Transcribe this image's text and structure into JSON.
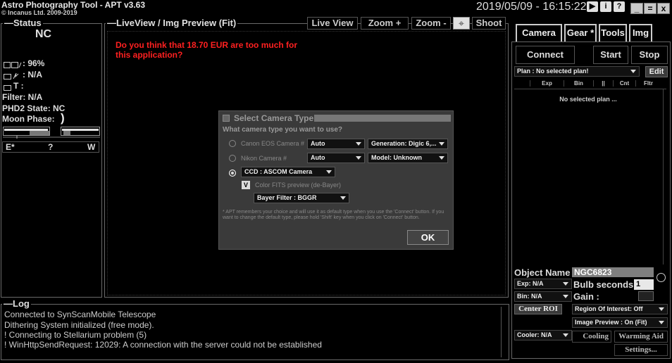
{
  "app": {
    "title": "Astro Photography Tool  -  APT v3.63",
    "copyright": "© Incanus Ltd. 2009-2019",
    "clock": "2019/05/09 - 16:15:22"
  },
  "title_buttons": [
    {
      "icon": "play-icon",
      "glyph": "▶"
    },
    {
      "icon": "info-icon",
      "glyph": "i"
    },
    {
      "icon": "help-icon",
      "glyph": "?"
    }
  ],
  "window_buttons": [
    {
      "icon": "minimize-icon",
      "glyph": "_"
    },
    {
      "icon": "maximize-icon",
      "glyph": "="
    },
    {
      "icon": "close-icon",
      "glyph": "x"
    }
  ],
  "status": {
    "legend": "Status",
    "connection": "NC",
    "battery": ": 96%",
    "power": ": N/A",
    "temp": "T :",
    "filter": "Filter: N/A",
    "phd2": "PHD2 State: NC",
    "moon": "Moon Phase:",
    "moon_glyph": ")",
    "compass": {
      "e": "E*",
      "mid": "?",
      "w": "W"
    }
  },
  "liveview": {
    "legend": "LiveView / Img Preview (Fit)",
    "buttons": [
      "Live View",
      "Zoom +",
      "Zoom -",
      "Shoot"
    ],
    "crosshair_glyph": "⌖",
    "nag": "Do you think that 18.70 EUR are too much for this application?"
  },
  "dialog": {
    "title": "Select Camera Type",
    "question": "What camera type you want to use?",
    "canon_label": "Canon EOS Camera #",
    "canon_mode": "Auto",
    "canon_generation": "Generation: Digic 6,...",
    "nikon_label": "Nikon Camera #",
    "nikon_mode": "Auto",
    "nikon_model": "Model: Unknown",
    "ccd_value": "CCD : ASCOM Camera",
    "check_glyph": "V",
    "color_fits": "Color FITS preview (de-Bayer)",
    "bayer_filter": "Bayer Filter : BGGR",
    "note": "* APT remembers your choice and will use it as default type when you use the 'Connect' button. If you want to change the default type, please hold 'Shift' key when you click on 'Connect' button.",
    "ok": "OK"
  },
  "right": {
    "tabs": [
      "Camera",
      "Gear *",
      "Tools",
      "Img"
    ],
    "connect": "Connect",
    "start": "Start",
    "stop": "Stop",
    "plan": "Plan : No selected plan!",
    "edit": "Edit",
    "plan_cols": [
      "",
      "Exp",
      "Bin",
      "||",
      "Cnt",
      "Fltr"
    ],
    "no_plan": "No selected plan ...",
    "object_label": "Object Name :",
    "object_value": "NGC6823",
    "exp": "Exp: N/A",
    "bulb_label": "Bulb seconds :",
    "bulb_value": "1",
    "bin": "Bin: N/A",
    "gain_label": "Gain :",
    "center_roi": "Center ROI",
    "roi": "Region Of Interest: Off",
    "image_preview": "Image Preview : On (Fit)",
    "cooler": "Cooler: N/A",
    "cooling_aid": "Cooling Aid",
    "warming_aid": "Warming Aid",
    "settings": "Settings..."
  },
  "log": {
    "legend": "Log",
    "lines": [
      "  Connected to SynScanMobile Telescope",
      "  Dithering System initialized (free mode).",
      "! Connecting to Stellarium problem (5)",
      "! WinHttpSendRequest: 12029: A connection with the server could not be established"
    ]
  },
  "colors": {
    "nag_text": "#ff2020",
    "object_bg": "#7f7f7f",
    "dialog_bg": "#3a3a3a"
  }
}
